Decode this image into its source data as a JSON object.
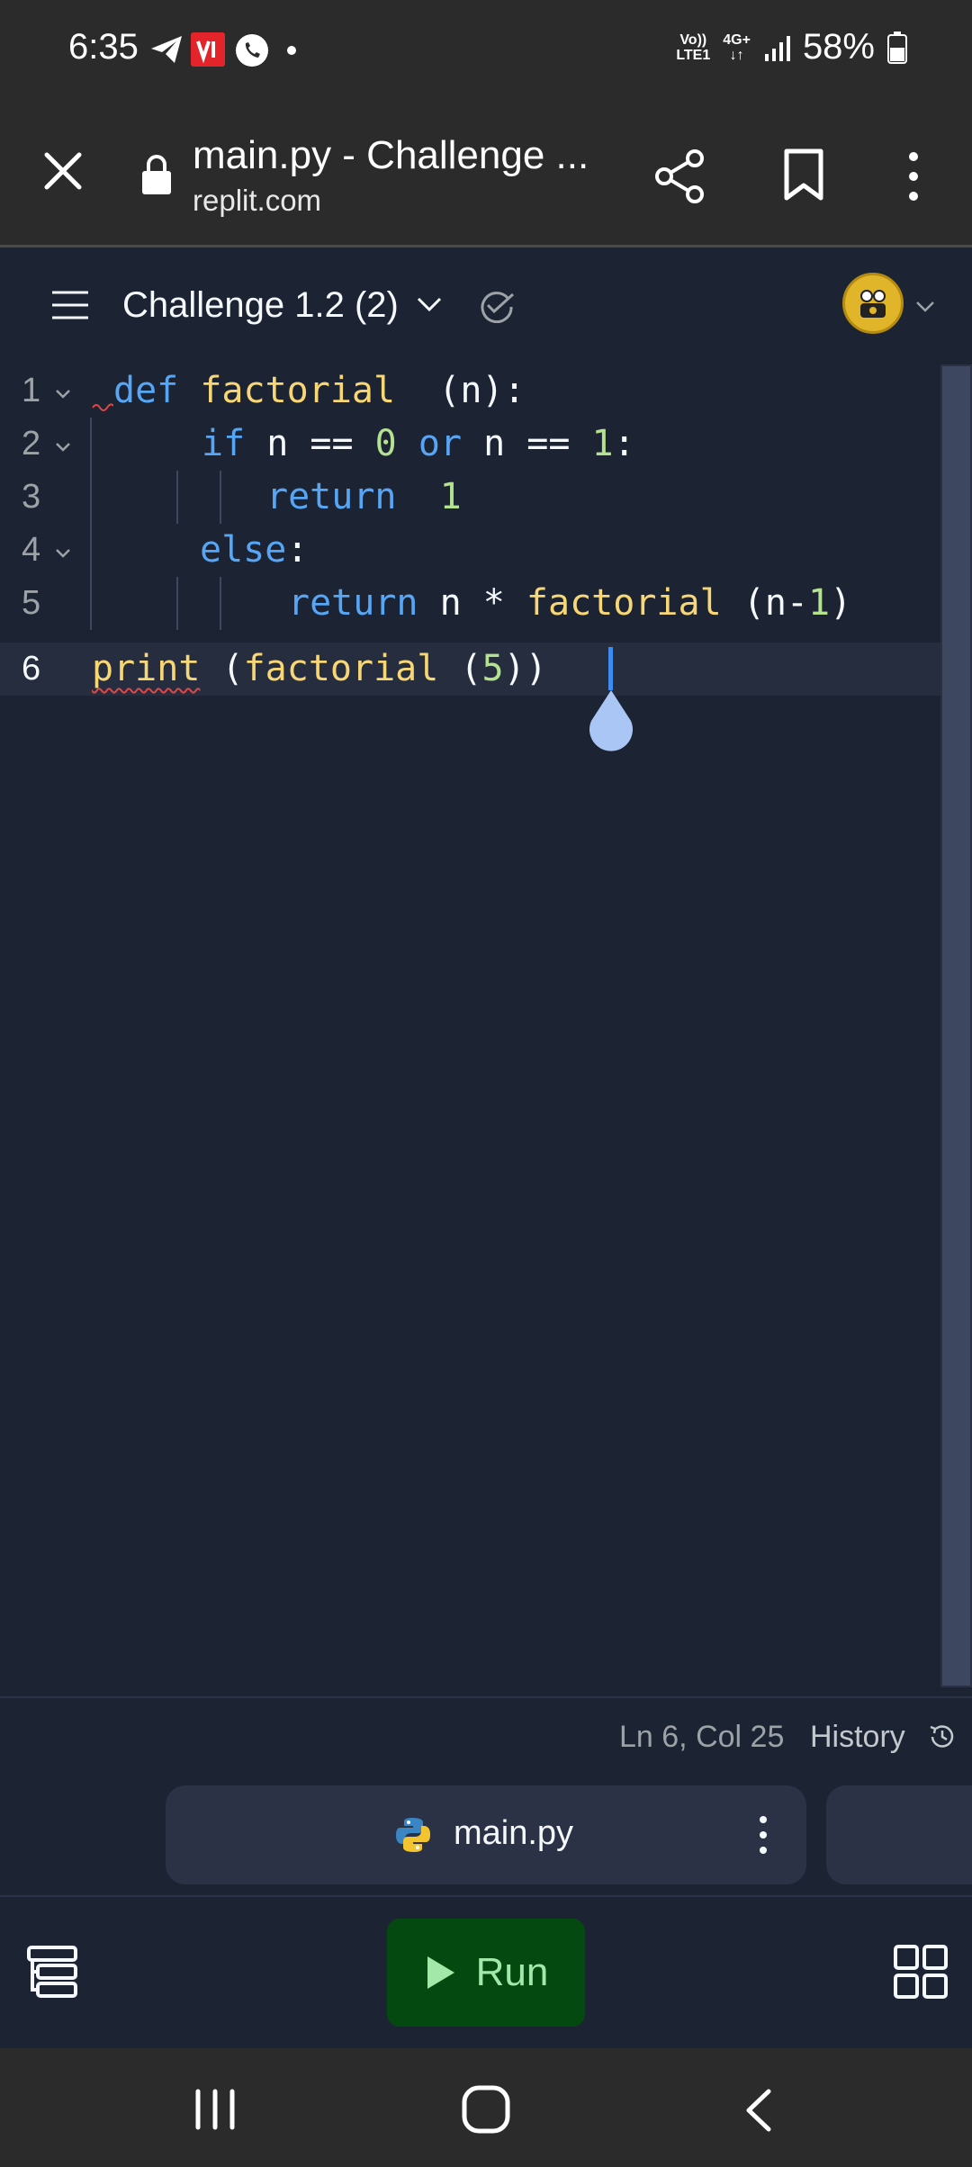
{
  "status_bar": {
    "time": "6:35",
    "network_top": "Vo))",
    "network_bottom": "LTE1",
    "data_top": "4G+",
    "data_bottom": "↓↑",
    "battery": "58%"
  },
  "browser": {
    "title": "main.py - Challenge ...",
    "url": "replit.com"
  },
  "repl_header": {
    "project_name": "Challenge 1.2 (2)"
  },
  "editor": {
    "line_numbers": [
      "1",
      "2",
      "3",
      "4",
      "5",
      "6"
    ],
    "lines": [
      {
        "t1": "def",
        "t2": "factorial",
        "t3": "  (n):"
      },
      {
        "t1": "if",
        "t2": " n == ",
        "t3": "0",
        "t4": "or",
        "t5": " n == ",
        "t6": "1",
        "t7": ":"
      },
      {
        "t1": "return",
        "t2": "1"
      },
      {
        "t1": "else",
        "t2": ":"
      },
      {
        "t1": "return",
        "t2": " n * ",
        "t3": "factorial",
        "t4": " (n-",
        "t5": "1",
        "t6": ")"
      },
      {
        "t1": "print",
        "t2": " (",
        "t3": "factorial",
        "t4": " (",
        "t5": "5",
        "t6": "))"
      }
    ]
  },
  "statusline": {
    "position": "Ln 6, Col 25",
    "history": "History"
  },
  "tabs": {
    "active_file": "main.py"
  },
  "toolbar": {
    "run_label": "Run"
  },
  "colors": {
    "background": "#1c2333",
    "keyword": "#56a6f5",
    "function": "#f7d675",
    "number": "#b5e290",
    "run_button": "#044a10",
    "run_text": "#a3e8a8"
  }
}
